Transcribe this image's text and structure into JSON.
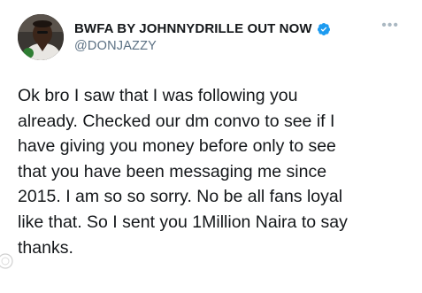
{
  "tweet": {
    "display_name": "BWFA BY JOHNNYDRILLE OUT NOW",
    "handle": "@DONJAZZY",
    "verified_icon": "verified-badge-icon",
    "verified_color": "#1d9bf0",
    "more_icon": "more-options-icon",
    "more_label": "•••",
    "text_lines": [
      "Ok bro I saw that I was following you",
      "already. Checked our dm convo to see if I",
      "have giving you money before only to see",
      "that you have been messaging me since",
      "2015. I am so so sorry. No be all fans loyal",
      "like that. So I sent you 1Million Naira to say",
      "thanks."
    ]
  }
}
